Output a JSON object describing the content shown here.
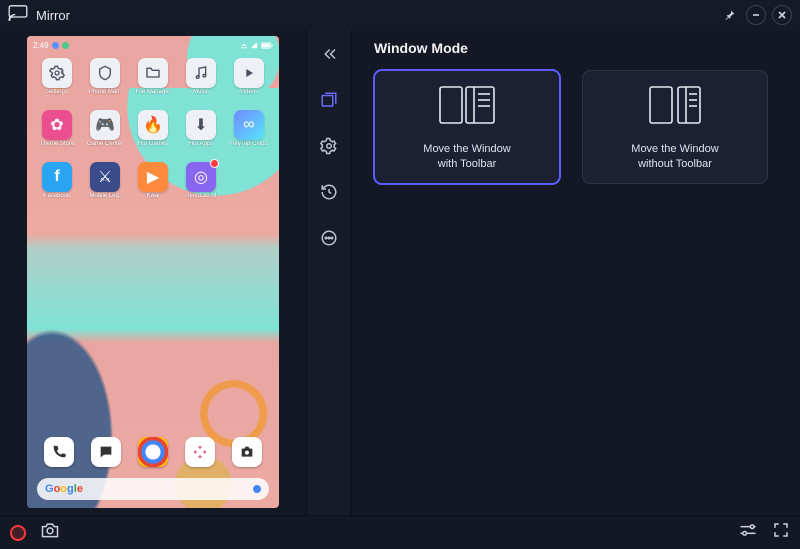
{
  "titlebar": {
    "title": "Mirror"
  },
  "toolbar": {
    "items": [
      {
        "name": "collapse-icon",
        "active": false
      },
      {
        "name": "window-mode-icon",
        "active": true
      },
      {
        "name": "settings-icon",
        "active": false
      },
      {
        "name": "history-icon",
        "active": false
      },
      {
        "name": "more-icon",
        "active": false
      }
    ]
  },
  "content": {
    "section_title": "Window Mode",
    "cards": [
      {
        "line1": "Move the Window",
        "line2": "with Toolbar",
        "selected": true
      },
      {
        "line1": "Move the Window",
        "line2": "without Toolbar",
        "selected": false
      }
    ]
  },
  "phone": {
    "clock": "2:49",
    "apps_row1": [
      "Settings",
      "Phone Man.",
      "File Manager",
      "Music",
      "Videos"
    ],
    "apps_row2": [
      "Theme Store",
      "Game Center",
      "Hot Games",
      "Hot Apps",
      "HeyTap Cloud"
    ],
    "apps_row3": [
      "Facebook",
      "Mobile Leg.",
      "Kwai",
      "TrendLab M.",
      ""
    ],
    "search_brand": "Google"
  }
}
